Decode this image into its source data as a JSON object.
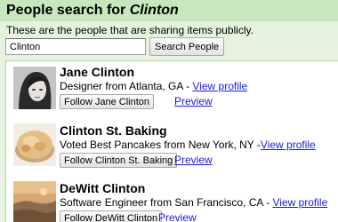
{
  "header": {
    "title_prefix": "People search for",
    "query": "Clinton"
  },
  "intro": "These are the people that are sharing items publicly.",
  "search": {
    "value": "Clinton",
    "button_label": "Search People"
  },
  "results": [
    {
      "name": "Jane Clinton",
      "description": "Designer from Atlanta, GA - ",
      "view_profile": "View profile",
      "follow_label": "Follow Jane Clinton",
      "preview_label": "Preview",
      "avatar": "portrait-photo"
    },
    {
      "name": "Clinton St. Baking",
      "description": "Voted Best Pancakes from New York, NY -",
      "view_profile": "View profile",
      "follow_label": "Follow Clinton St. Baking",
      "preview_label": "Preview",
      "avatar": "biscuit-photo"
    },
    {
      "name": "DeWitt Clinton",
      "description": "Software Engineer from San Francisco, CA - ",
      "view_profile": "View profile",
      "follow_label": "Follow DeWitt Clinton",
      "preview_label": "Preview",
      "avatar": "landscape-photo"
    }
  ]
}
